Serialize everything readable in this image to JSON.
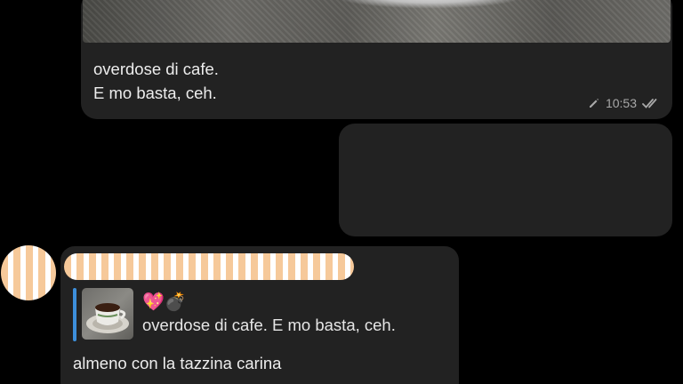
{
  "messages": [
    {
      "direction": "outgoing",
      "has_photo": true,
      "caption_lines": [
        "overdose di cafe.",
        "E mo basta, ceh."
      ],
      "edited": true,
      "time": "10:53",
      "status": "read"
    },
    {
      "direction": "outgoing",
      "content_hidden": true
    },
    {
      "direction": "incoming",
      "sender_name_hidden": true,
      "reply_preview": {
        "emojis": "💖💣",
        "text": "overdose di cafe. E mo basta, ceh."
      },
      "text": "almeno con la tazzina carina"
    }
  ],
  "colors": {
    "background": "#000000",
    "bubble": "#222222",
    "reply_accent": "#3d8fdb",
    "meta_text": "#a9a9a9"
  },
  "icons": [
    "pencil-icon",
    "double-check-icon"
  ]
}
